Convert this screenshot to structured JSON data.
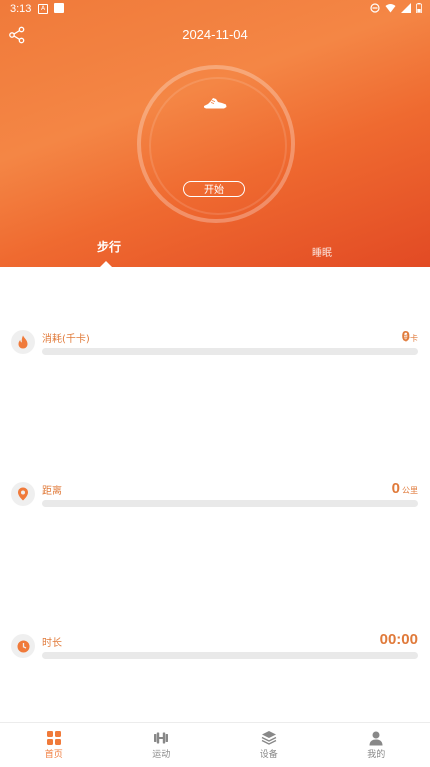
{
  "status_bar": {
    "time": "3:13",
    "notif_a": "A"
  },
  "header": {
    "date": "2024-11-04",
    "start_label": "开始"
  },
  "tabs": [
    {
      "label": "步行"
    },
    {
      "label": "睡眠"
    }
  ],
  "metrics": [
    {
      "label": "消耗(千卡)",
      "value": "0",
      "unit": "千卡",
      "progress": 0
    },
    {
      "label": "距离",
      "value": "0",
      "unit": "公里",
      "progress": 0
    },
    {
      "label": "时长",
      "value": "00:00",
      "unit": "",
      "progress": 0
    }
  ],
  "bottom_nav": [
    {
      "label": "首页",
      "icon": "grid-icon"
    },
    {
      "label": "运动",
      "icon": "dumbbell-icon"
    },
    {
      "label": "设备",
      "icon": "layers-icon"
    },
    {
      "label": "我的",
      "icon": "person-icon"
    }
  ],
  "colors": {
    "accent": "#f07a3a",
    "hero_top": "#f48645",
    "hero_bottom": "#e24a24",
    "bar_bg": "#e9e9e9"
  }
}
